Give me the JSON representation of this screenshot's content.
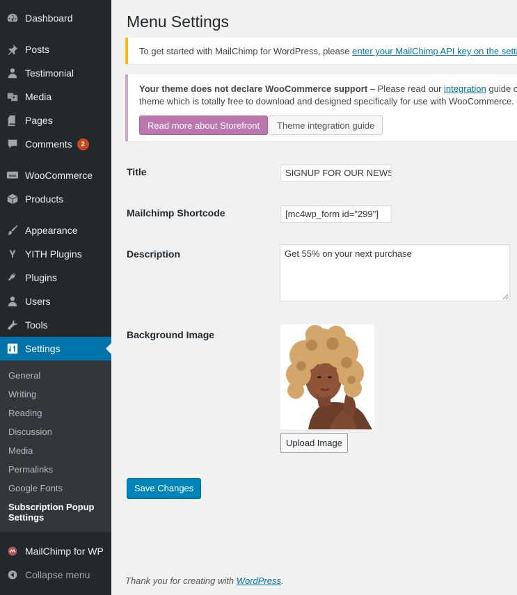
{
  "sidebar": {
    "items": [
      {
        "label": "Dashboard",
        "icon": "dashboard-icon"
      },
      {
        "label": "Posts",
        "icon": "pin-icon"
      },
      {
        "label": "Testimonial",
        "icon": "person-icon"
      },
      {
        "label": "Media",
        "icon": "media-icon"
      },
      {
        "label": "Pages",
        "icon": "pages-icon"
      },
      {
        "label": "Comments",
        "icon": "comment-icon",
        "badge": "2"
      },
      {
        "label": "WooCommerce",
        "icon": "woo-icon"
      },
      {
        "label": "Products",
        "icon": "box-icon"
      },
      {
        "label": "Appearance",
        "icon": "brush-icon"
      },
      {
        "label": "YITH Plugins",
        "icon": "yith-icon"
      },
      {
        "label": "Plugins",
        "icon": "plug-icon"
      },
      {
        "label": "Users",
        "icon": "users-icon"
      },
      {
        "label": "Tools",
        "icon": "wrench-icon"
      },
      {
        "label": "Settings",
        "icon": "settings-icon",
        "active": true
      }
    ],
    "submenu": [
      "General",
      "Writing",
      "Reading",
      "Discussion",
      "Media",
      "Permalinks",
      "Google Fonts",
      "Subscription Popup Settings"
    ],
    "mailchimp_label": "MailChimp for WP",
    "collapse_label": "Collapse menu"
  },
  "page": {
    "title": "Menu Settings"
  },
  "notices": {
    "mailchimp_text": "To get started with MailChimp for WordPress, please ",
    "mailchimp_link": "enter your MailChimp API key on the setti",
    "woo_bold": "Your theme does not declare WooCommerce support",
    "woo_text_1": " – Please read our ",
    "woo_link": "integration",
    "woo_text_2": " guide or c",
    "woo_line2": "theme which is totally free to download and designed specifically for use with WooCommerce.",
    "storefront_button": "Read more about Storefront",
    "guide_button": "Theme integration guide"
  },
  "form": {
    "title_label": "Title",
    "title_value": "SIGNUP FOR OUR NEWSLETTER",
    "shortcode_label": "Mailchimp Shortcode",
    "shortcode_value": "[mc4wp_form id=\"299\"]",
    "description_label": "Description",
    "description_value": "Get 55% on your next purchase",
    "bg_label": "Background Image",
    "upload_button": "Upload Image",
    "save_button": "Save Changes"
  },
  "footer": {
    "text": "Thank you for creating with ",
    "link": "WordPress",
    "end": "."
  },
  "colors": {
    "sidebar_bg": "#23282d",
    "active_bg": "#0073aa",
    "primary_button": "#0085ba",
    "storefront_button": "#bb77ae",
    "badge": "#ca4a1f"
  }
}
